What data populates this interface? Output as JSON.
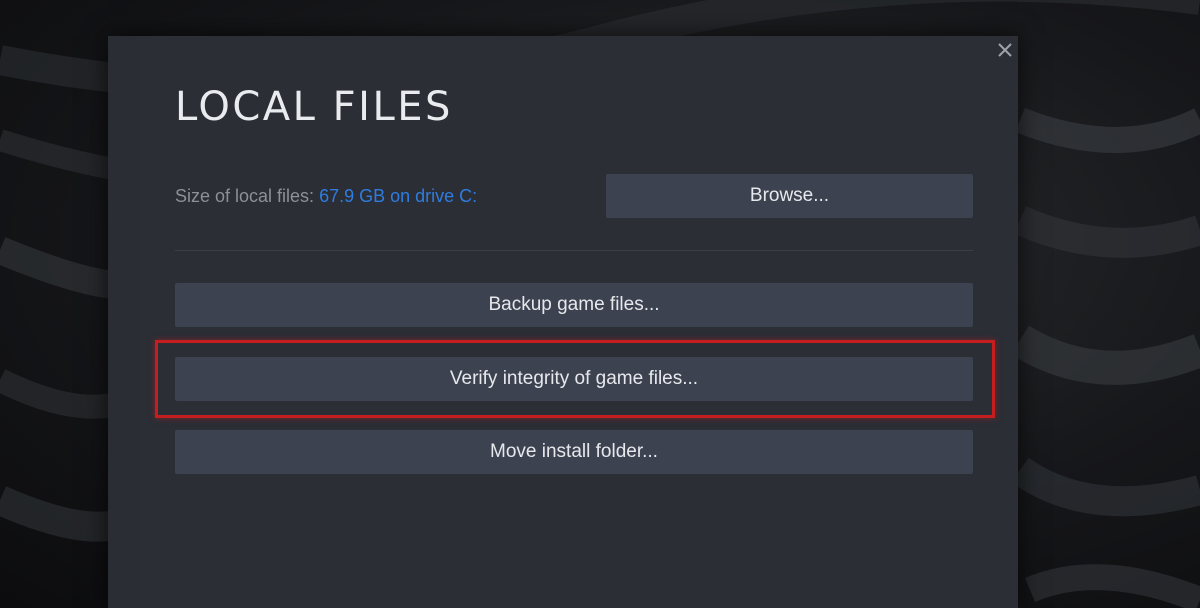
{
  "dialog": {
    "title": "LOCAL FILES",
    "close_icon": "close-icon",
    "size_label": "Size of local files:",
    "size_value": "67.9 GB on drive C:",
    "browse_label": "Browse...",
    "backup_label": "Backup game files...",
    "verify_label": "Verify integrity of game files...",
    "move_label": "Move install folder..."
  },
  "colors": {
    "dialog_bg": "#2b2e35",
    "button_bg": "#3d4250",
    "link_blue": "#2f7ce0",
    "highlight_red": "#c41e1e"
  }
}
